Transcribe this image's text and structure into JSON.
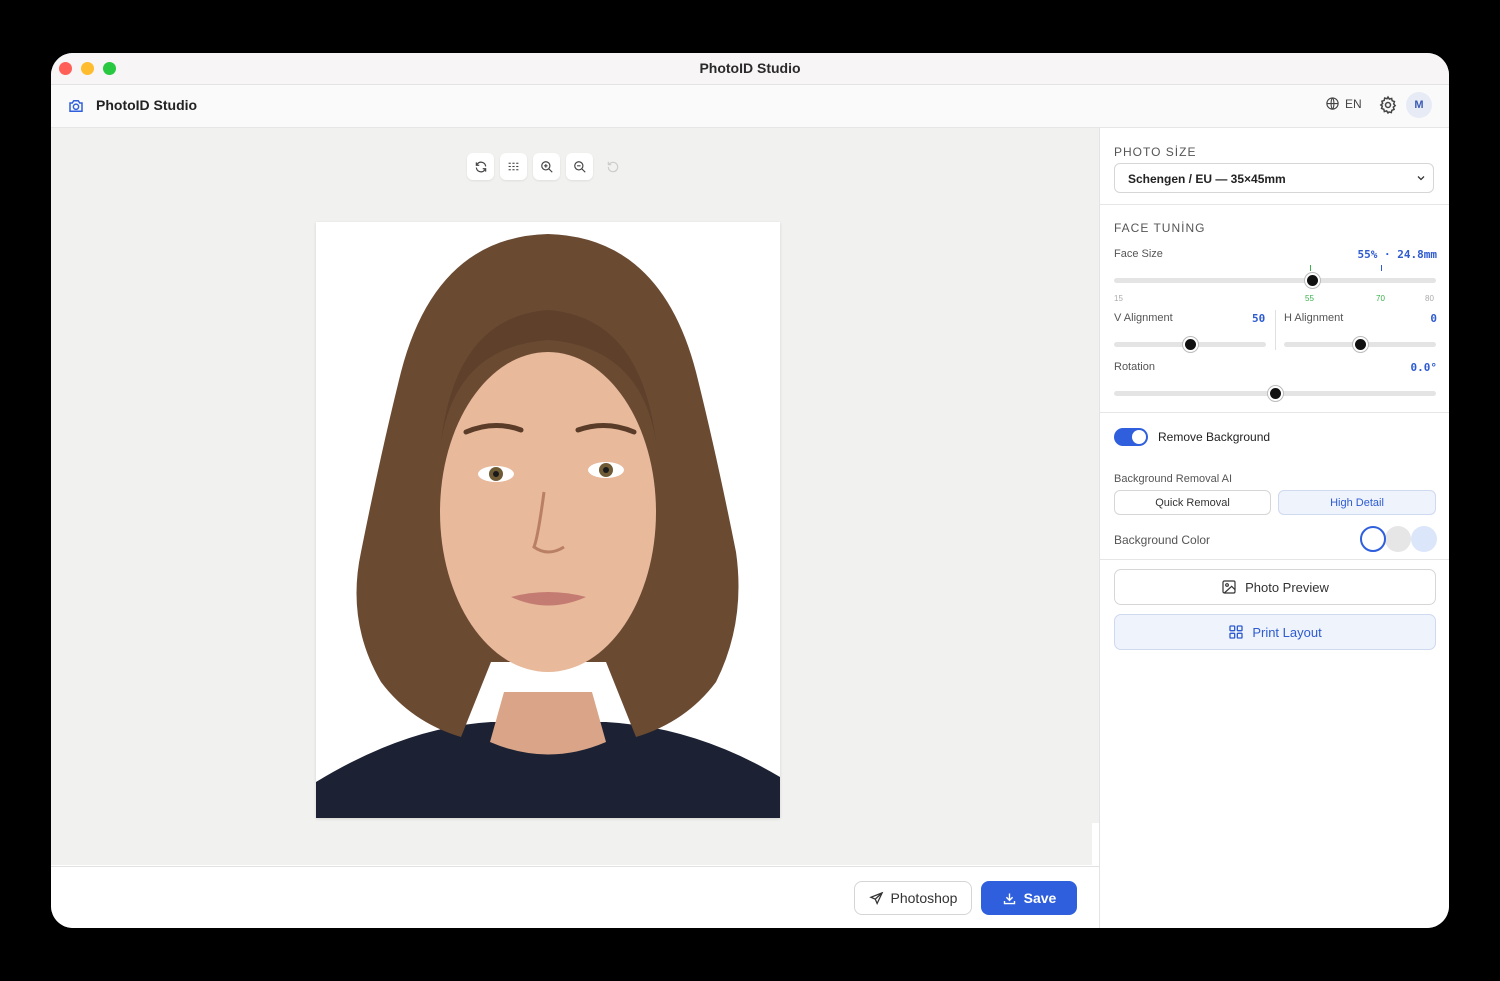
{
  "window": {
    "title": "PhotoID Studio"
  },
  "header": {
    "app_name": "PhotoID Studio",
    "app_icon": "camera-icon",
    "language": "EN",
    "language_icon": "globe-icon",
    "settings_icon": "gear-icon",
    "avatar_initial": "M"
  },
  "toolbar": {
    "buttons": [
      {
        "icon": "refresh-icon",
        "enabled": true
      },
      {
        "icon": "grid-icon",
        "enabled": true
      },
      {
        "icon": "zoom-in-icon",
        "enabled": true
      },
      {
        "icon": "zoom-out-icon",
        "enabled": true
      },
      {
        "icon": "undo-icon",
        "enabled": false
      }
    ]
  },
  "footer": {
    "photoshop_label": "Photoshop",
    "save_label": "Save"
  },
  "panel": {
    "photo_size": {
      "title": "PHOTO SİZE",
      "selected": "Schengen / EU — 35×45mm"
    },
    "face_tuning": {
      "title": "FACE TUNİNG",
      "face_size": {
        "label": "Face Size",
        "value_text": "55% · 24.8mm",
        "value": 55,
        "min": 15,
        "max": 80,
        "ticks": [
          "15",
          "55",
          "70",
          "80"
        ]
      },
      "v_alignment": {
        "label": "V Alignment",
        "value_text": "50",
        "value": 50
      },
      "h_alignment": {
        "label": "H Alignment",
        "value_text": "0",
        "value": 0
      },
      "rotation": {
        "label": "Rotation",
        "value_text": "0.0°",
        "value": 0
      }
    },
    "background": {
      "remove_label": "Remove Background",
      "remove_enabled": true,
      "ai_label": "Background Removal AI",
      "ai_options": [
        "Quick Removal",
        "High Detail"
      ],
      "ai_selected": "High Detail",
      "color_label": "Background Color",
      "colors": [
        "#ffffff",
        "#e6e6e6",
        "#dbe6fb"
      ],
      "selected_color": "#ffffff"
    },
    "photo_preview_label": "Photo Preview",
    "print_layout_label": "Print Layout"
  },
  "colors": {
    "accent": "#2f5fdc",
    "accent_text": "#2e5bd0",
    "green_tick": "#3ab14b"
  }
}
